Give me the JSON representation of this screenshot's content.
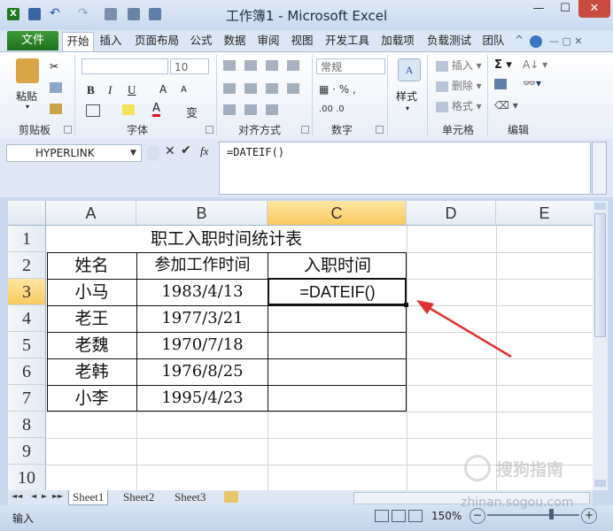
{
  "window": {
    "title": "工作簿1 - Microsoft Excel"
  },
  "ribbon_tabs": [
    "文件",
    "开始",
    "插入",
    "页面布局",
    "公式",
    "数据",
    "审阅",
    "视图",
    "开发工具",
    "加载项",
    "负载测试",
    "团队"
  ],
  "ribbon": {
    "paste_label": "粘贴",
    "font_size": "10",
    "number_format": "常规",
    "styles_label": "样式",
    "insert_label": "插入",
    "delete_label": "删除",
    "format_label": "格式",
    "groups": {
      "clipboard": "剪贴板",
      "font": "字体",
      "alignment": "对齐方式",
      "number": "数字",
      "cells": "单元格",
      "editing": "编辑"
    }
  },
  "formula_bar": {
    "name_box": "HYPERLINK",
    "formula": "=DATEIF()"
  },
  "sheet": {
    "columns": [
      "A",
      "B",
      "C",
      "D",
      "E"
    ],
    "rows": [
      "1",
      "2",
      "3",
      "4",
      "5",
      "6",
      "7",
      "8",
      "9",
      "10"
    ],
    "title": "职工入职时间统计表",
    "headers": [
      "姓名",
      "参加工作时间",
      "入职时间"
    ],
    "records": [
      {
        "name": "小马",
        "date": "1983/4/13",
        "result": "=DATEIF()"
      },
      {
        "name": "老王",
        "date": "1977/3/21",
        "result": ""
      },
      {
        "name": "老魏",
        "date": "1970/7/18",
        "result": ""
      },
      {
        "name": "老韩",
        "date": "1976/8/25",
        "result": ""
      },
      {
        "name": "小李",
        "date": "1995/4/23",
        "result": ""
      }
    ]
  },
  "sheet_tabs": [
    "Sheet1",
    "Sheet2",
    "Sheet3"
  ],
  "status": {
    "mode": "输入",
    "zoom": "150%"
  },
  "watermark": "zhinan.sogou.com",
  "colors": {
    "accent_green": "#1e6f1c",
    "selected_header": "#f8c95f",
    "arrow_red": "#e03131"
  }
}
